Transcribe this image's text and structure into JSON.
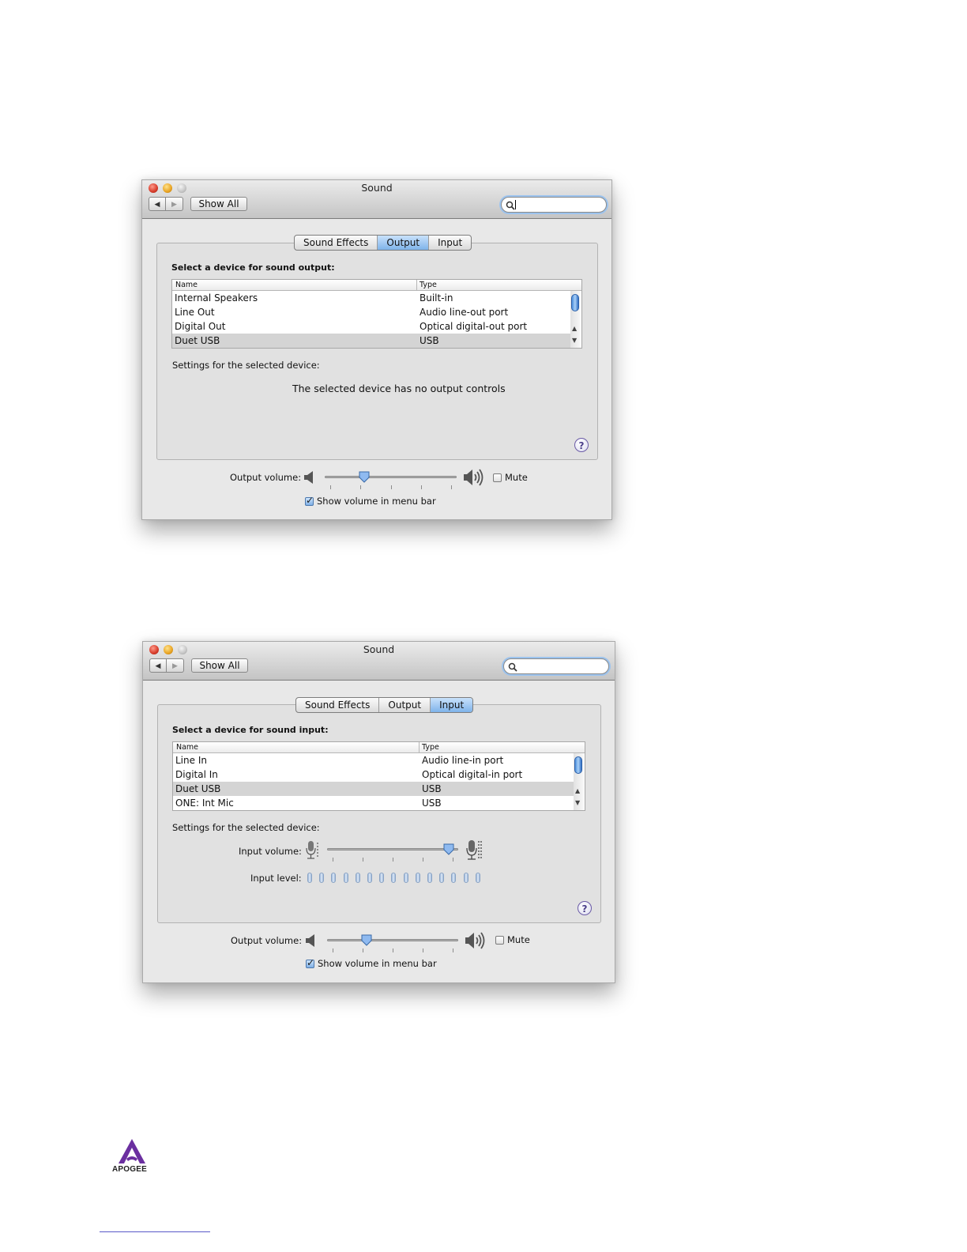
{
  "windows": [
    {
      "title": "Sound",
      "toolbar": {
        "back_icon": "◀",
        "forward_icon": "▶",
        "show_all_label": "Show All",
        "search_value": ""
      },
      "tabs": [
        {
          "label": "Sound Effects",
          "selected": false
        },
        {
          "label": "Output",
          "selected": true
        },
        {
          "label": "Input",
          "selected": false
        }
      ],
      "section_heading": "Select a device for sound output:",
      "table": {
        "columns": [
          "Name",
          "Type"
        ],
        "rows": [
          {
            "name": "Internal Speakers",
            "type": "Built-in"
          },
          {
            "name": "Line Out",
            "type": "Audio line-out port"
          },
          {
            "name": "Digital Out",
            "type": "Optical digital-out port"
          },
          {
            "name": "Duet USB",
            "type": "USB",
            "selected": true
          }
        ]
      },
      "settings_label": "Settings for the selected device:",
      "no_controls_message": "The selected device has no output controls",
      "help_label": "?",
      "output_volume": {
        "label": "Output volume:",
        "value": 0.28,
        "mute_label": "Mute",
        "muted": false
      },
      "show_volume": {
        "label": "Show volume in menu bar",
        "checked": true
      }
    },
    {
      "title": "Sound",
      "toolbar": {
        "back_icon": "◀",
        "forward_icon": "▶",
        "show_all_label": "Show All",
        "search_value": ""
      },
      "tabs": [
        {
          "label": "Sound Effects",
          "selected": false
        },
        {
          "label": "Output",
          "selected": false
        },
        {
          "label": "Input",
          "selected": true
        }
      ],
      "section_heading": "Select a device for sound input:",
      "table": {
        "columns": [
          "Name",
          "Type"
        ],
        "rows": [
          {
            "name": "Line In",
            "type": "Audio line-in port"
          },
          {
            "name": "Digital In",
            "type": "Optical digital-in port"
          },
          {
            "name": "Duet USB",
            "type": "USB",
            "selected": true
          },
          {
            "name": "ONE: Int Mic",
            "type": "USB"
          }
        ]
      },
      "settings_label": "Settings for the selected device:",
      "input_volume": {
        "label": "Input volume:",
        "value": 0.97
      },
      "input_level": {
        "label": "Input level:",
        "segments": 15,
        "lit": 0
      },
      "help_label": "?",
      "output_volume": {
        "label": "Output volume:",
        "value": 0.28,
        "mute_label": "Mute",
        "muted": false
      },
      "show_volume": {
        "label": "Show volume in menu bar",
        "checked": true
      }
    }
  ],
  "logo": {
    "text": "APOGEE",
    "color": "#6b2fa0"
  },
  "colors": {
    "accent_blue": "#7fb3ea",
    "selected_row": "#d4d4d4",
    "window_bg": "#e8e8e8"
  }
}
